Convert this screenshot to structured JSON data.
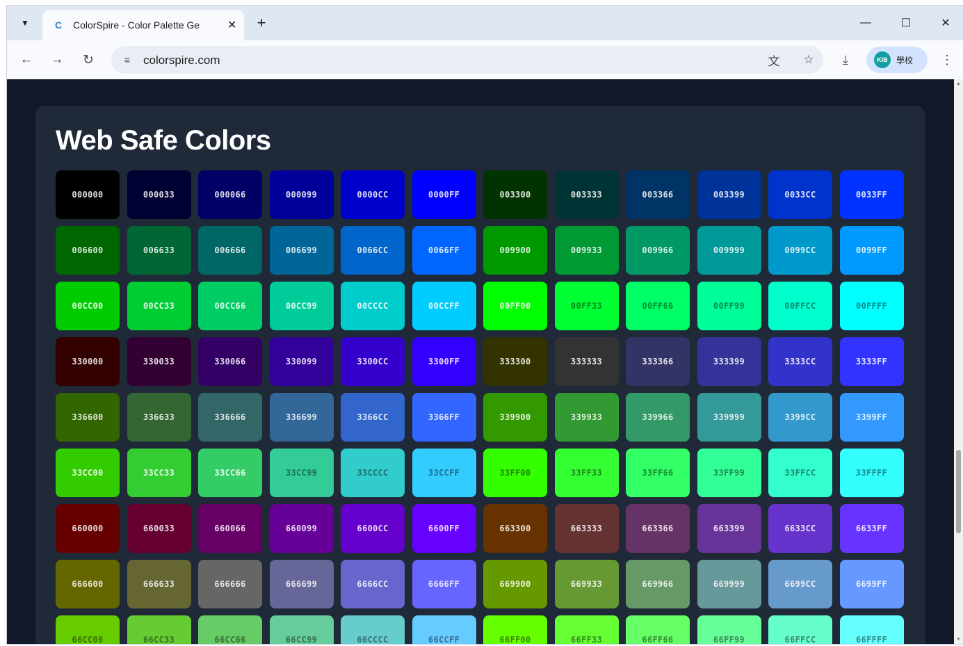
{
  "browser": {
    "tab_title": "ColorSpire - Color Palette Ge",
    "tab_favicon": "C",
    "new_tab_symbol": "+",
    "url": "colorspire.com",
    "profile_label": "學校",
    "profile_initials": "KIB"
  },
  "page": {
    "section_title": "Web Safe Colors",
    "colors": [
      "000000",
      "000033",
      "000066",
      "000099",
      "0000CC",
      "0000FF",
      "003300",
      "003333",
      "003366",
      "003399",
      "0033CC",
      "0033FF",
      "006600",
      "006633",
      "006666",
      "006699",
      "0066CC",
      "0066FF",
      "009900",
      "009933",
      "009966",
      "009999",
      "0099CC",
      "0099FF",
      "00CC00",
      "00CC33",
      "00CC66",
      "00CC99",
      "00CCCC",
      "00CCFF",
      "00FF00",
      "00FF33",
      "00FF66",
      "00FF99",
      "00FFCC",
      "00FFFF",
      "330000",
      "330033",
      "330066",
      "330099",
      "3300CC",
      "3300FF",
      "333300",
      "333333",
      "333366",
      "333399",
      "3333CC",
      "3333FF",
      "336600",
      "336633",
      "336666",
      "336699",
      "3366CC",
      "3366FF",
      "339900",
      "339933",
      "339966",
      "339999",
      "3399CC",
      "3399FF",
      "33CC00",
      "33CC33",
      "33CC66",
      "33CC99",
      "33CCCC",
      "33CCFF",
      "33FF00",
      "33FF33",
      "33FF66",
      "33FF99",
      "33FFCC",
      "33FFFF",
      "660000",
      "660033",
      "660066",
      "660099",
      "6600CC",
      "6600FF",
      "663300",
      "663333",
      "663366",
      "663399",
      "6633CC",
      "6633FF",
      "666600",
      "666633",
      "666666",
      "666699",
      "6666CC",
      "6666FF",
      "669900",
      "669933",
      "669966",
      "669999",
      "6699CC",
      "6699FF",
      "66CC00",
      "66CC33",
      "66CC66",
      "66CC99",
      "66CCCC",
      "66CCFF",
      "66FF00",
      "66FF33",
      "66FF66",
      "66FF99",
      "66FFCC",
      "66FFFF"
    ]
  },
  "icons": {
    "tab_menu": "chevron-down-icon",
    "back": "back-arrow-icon",
    "forward": "forward-arrow-icon",
    "reload": "reload-icon",
    "site_info": "site-info-icon",
    "translate": "translate-icon",
    "bookmark": "star-icon",
    "download": "download-icon",
    "menu": "more-vert-icon"
  },
  "colors": {
    "page_bg": "#111827",
    "card_bg": "#1f2937",
    "title_text": "#ffffff"
  }
}
